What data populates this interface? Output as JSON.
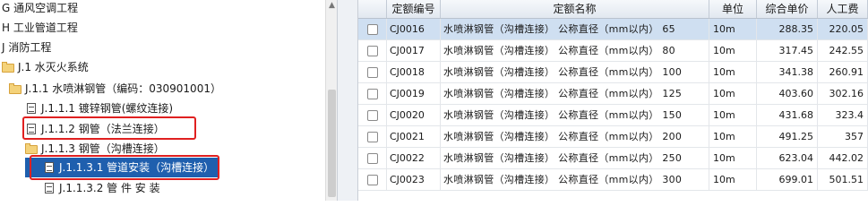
{
  "tree": {
    "items": [
      {
        "label": "G 通风空调工程",
        "icon": "none",
        "selected": false
      },
      {
        "label": "H 工业管道工程",
        "icon": "none",
        "selected": false
      },
      {
        "label": "J 消防工程",
        "icon": "none",
        "selected": false
      },
      {
        "label": "J.1 水灭火系统",
        "icon": "folder-icon",
        "selected": false
      },
      {
        "label": "J.1.1 水喷淋钢管（编码：030901001）",
        "icon": "folder-icon",
        "selected": false
      },
      {
        "label": "J.1.1.1 镀锌钢管(螺纹连接)",
        "icon": "document-icon",
        "selected": false
      },
      {
        "label": "J.1.1.2 钢管（法兰连接）",
        "icon": "document-icon",
        "selected": false
      },
      {
        "label": "J.1.1.3 钢管（沟槽连接）",
        "icon": "folder-icon",
        "selected": false
      },
      {
        "label": "J.1.1.3.1 管道安装（沟槽连接）",
        "icon": "document-icon",
        "selected": true
      },
      {
        "label": "J.1.1.3.2 管 件 安 装",
        "icon": "document-icon",
        "selected": false
      }
    ]
  },
  "grid": {
    "headers": [
      "定额编号",
      "定额名称",
      "单位",
      "综合单价",
      "人工费"
    ],
    "rows": [
      {
        "code": "CJ0016",
        "name": "水喷淋钢管（沟槽连接） 公称直径（mm以内） 65",
        "unit": "10m",
        "price": "288.35",
        "labor": "220.05"
      },
      {
        "code": "CJ0017",
        "name": "水喷淋钢管（沟槽连接） 公称直径（mm以内） 80",
        "unit": "10m",
        "price": "317.45",
        "labor": "242.55"
      },
      {
        "code": "CJ0018",
        "name": "水喷淋钢管（沟槽连接） 公称直径（mm以内） 100",
        "unit": "10m",
        "price": "341.38",
        "labor": "260.91"
      },
      {
        "code": "CJ0019",
        "name": "水喷淋钢管（沟槽连接） 公称直径（mm以内） 125",
        "unit": "10m",
        "price": "403.60",
        "labor": "302.16"
      },
      {
        "code": "CJ0020",
        "name": "水喷淋钢管（沟槽连接） 公称直径（mm以内） 150",
        "unit": "10m",
        "price": "431.68",
        "labor": "323.4"
      },
      {
        "code": "CJ0021",
        "name": "水喷淋钢管（沟槽连接） 公称直径（mm以内） 200",
        "unit": "10m",
        "price": "491.25",
        "labor": "357"
      },
      {
        "code": "CJ0022",
        "name": "水喷淋钢管（沟槽连接） 公称直径（mm以内） 250",
        "unit": "10m",
        "price": "623.04",
        "labor": "442.02"
      },
      {
        "code": "CJ0023",
        "name": "水喷淋钢管（沟槽连接） 公称直径（mm以内） 300",
        "unit": "10m",
        "price": "699.01",
        "labor": "501.51"
      }
    ]
  },
  "colors": {
    "selection": "#1f5fae",
    "highlight_row": "#cfdff1",
    "annotation": "#e02020"
  }
}
